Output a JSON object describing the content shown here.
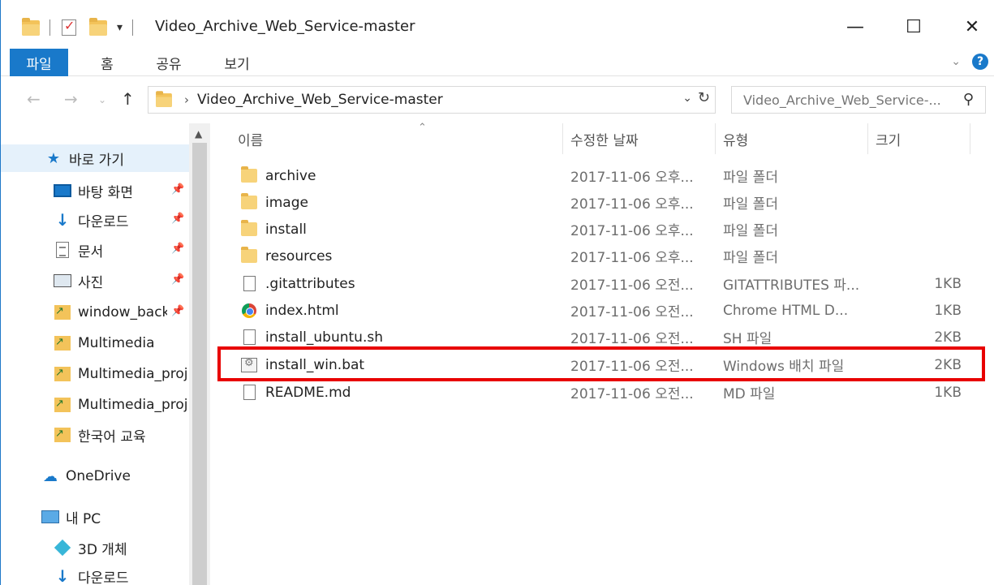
{
  "window": {
    "title": "Video_Archive_Web_Service-master",
    "minimize_glyph": "—",
    "maximize_glyph": "☐",
    "close_glyph": "✕"
  },
  "ribbon": {
    "tabs": [
      {
        "label": "파일",
        "active": true
      },
      {
        "label": "홈",
        "active": false
      },
      {
        "label": "공유",
        "active": false
      },
      {
        "label": "보기",
        "active": false
      }
    ],
    "help_glyph": "?"
  },
  "address": {
    "path": "Video_Archive_Web_Service-master",
    "separator": "›"
  },
  "search": {
    "placeholder": "Video_Archive_Web_Service-..."
  },
  "sidebar": {
    "items": [
      {
        "label": "바로 가기",
        "icon": "star-icon",
        "pinned": false
      },
      {
        "label": "바탕 화면",
        "icon": "desktop-icon",
        "pinned": true
      },
      {
        "label": "다운로드",
        "icon": "download-icon",
        "pinned": true
      },
      {
        "label": "문서",
        "icon": "document-icon",
        "pinned": true
      },
      {
        "label": "사진",
        "icon": "pictures-icon",
        "pinned": true
      },
      {
        "label": "window_back",
        "icon": "folder-shortcut-icon",
        "pinned": true
      },
      {
        "label": "Multimedia",
        "icon": "folder-shortcut-icon",
        "pinned": false
      },
      {
        "label": "Multimedia_proj",
        "icon": "folder-shortcut-icon",
        "pinned": false
      },
      {
        "label": "Multimedia_proj",
        "icon": "folder-shortcut-icon",
        "pinned": false
      },
      {
        "label": "한국어 교육",
        "icon": "folder-shortcut-icon",
        "pinned": false
      },
      {
        "label": "OneDrive",
        "icon": "onedrive-icon",
        "pinned": false
      },
      {
        "label": "내 PC",
        "icon": "pc-icon",
        "pinned": false
      },
      {
        "label": "3D 개체",
        "icon": "3d-objects-icon",
        "pinned": false
      },
      {
        "label": "다운로드",
        "icon": "download-icon",
        "pinned": false
      }
    ]
  },
  "columns": {
    "name": "이름",
    "date": "수정한 날짜",
    "type": "유형",
    "size": "크기"
  },
  "files": [
    {
      "name": "archive",
      "date": "2017-11-06 오후...",
      "type": "파일 폴더",
      "size": "",
      "icon": "folder-icon"
    },
    {
      "name": "image",
      "date": "2017-11-06 오후...",
      "type": "파일 폴더",
      "size": "",
      "icon": "folder-icon"
    },
    {
      "name": "install",
      "date": "2017-11-06 오후...",
      "type": "파일 폴더",
      "size": "",
      "icon": "folder-icon"
    },
    {
      "name": "resources",
      "date": "2017-11-06 오후...",
      "type": "파일 폴더",
      "size": "",
      "icon": "folder-icon"
    },
    {
      "name": ".gitattributes",
      "date": "2017-11-06 오전...",
      "type": "GITATTRIBUTES 파...",
      "size": "1KB",
      "icon": "blank-file-icon"
    },
    {
      "name": "index.html",
      "date": "2017-11-06 오전...",
      "type": "Chrome HTML D...",
      "size": "1KB",
      "icon": "chrome-icon"
    },
    {
      "name": "install_ubuntu.sh",
      "date": "2017-11-06 오전...",
      "type": "SH 파일",
      "size": "2KB",
      "icon": "blank-file-icon"
    },
    {
      "name": "install_win.bat",
      "date": "2017-11-06 오전...",
      "type": "Windows 배치 파일",
      "size": "2KB",
      "icon": "batch-file-icon"
    },
    {
      "name": "README.md",
      "date": "2017-11-06 오전...",
      "type": "MD 파일",
      "size": "1KB",
      "icon": "blank-file-icon"
    }
  ],
  "colors": {
    "accent": "#1979ca",
    "highlight": "#e80000"
  }
}
